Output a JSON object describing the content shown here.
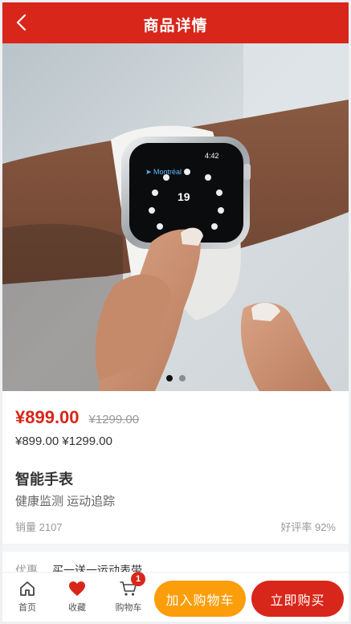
{
  "header": {
    "title": "商品详情",
    "back_icon": "chevron-left-icon"
  },
  "gallery": {
    "image": "smartwatch-on-wrist",
    "slide_count": 2,
    "active_slide": 1,
    "watch_screen": {
      "city": "Montréal",
      "time": "4:42",
      "center": "19"
    }
  },
  "product": {
    "price_now": "¥899.00",
    "price_old": "¥1299.00",
    "price_plain": "¥899.00 ¥1299.00",
    "name": "智能手表",
    "subtitle": "健康监测 运动追踪",
    "sales": "销量 2107",
    "rating": "好评率 92%"
  },
  "promo": {
    "label": "优惠",
    "text": "买一送一运动表带"
  },
  "tabbar": {
    "home": "首页",
    "favorites": "收藏",
    "cart": "购物车",
    "cart_badge": "1",
    "add_to_cart": "加入购物车",
    "buy_now": "立即购买"
  },
  "colors": {
    "brand": "#d8261a",
    "cart_button": "#fb9e0a"
  }
}
